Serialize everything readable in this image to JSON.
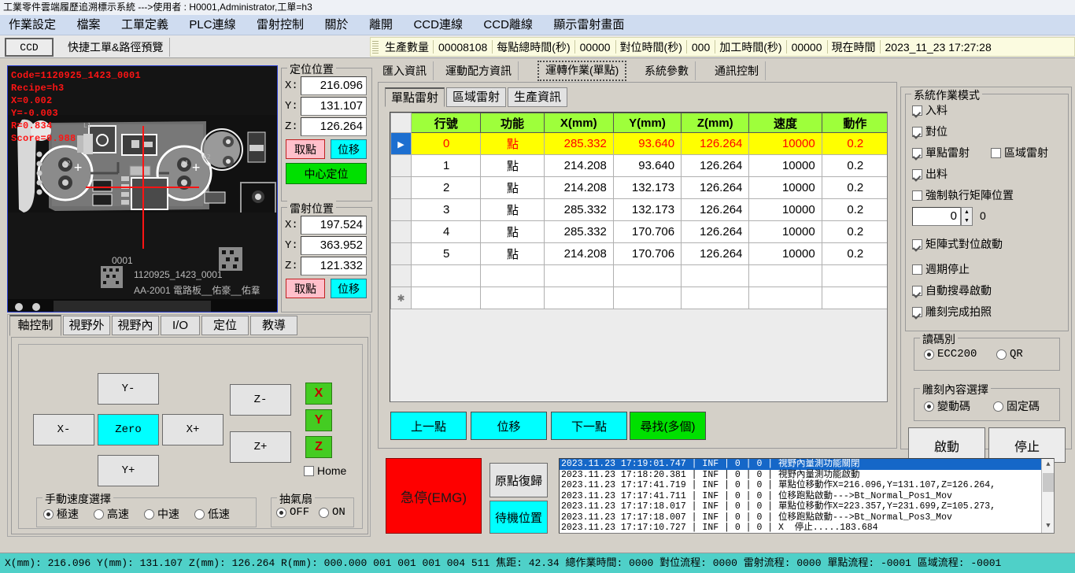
{
  "window": {
    "title": "工業零件雲端履歷追溯標示系統 --->使用者 : H0001,Administrator,工單=h3"
  },
  "menu": {
    "items": [
      "作業設定",
      "檔案",
      "工單定義",
      "PLC連線",
      "雷射控制",
      "關於",
      "離開",
      "CCD連線",
      "CCD離線",
      "顯示雷射畫面"
    ]
  },
  "tabstrip": {
    "ccd_tab": "CCD",
    "shortcut_label": "快捷工單&路徑預覽"
  },
  "statustool": {
    "qty_label": "生產數量",
    "qty_value": "00008108",
    "point_time_label": "每點總時間(秒)",
    "point_time_value": "00000",
    "align_time_label": "對位時間(秒)",
    "align_time_value": "000",
    "process_time_label": "加工時間(秒)",
    "process_time_value": "00000",
    "now_label": "現在時間",
    "now_value": "2023_11_23  17:27:28"
  },
  "camera": {
    "overlay": [
      "Code=1120925_1423_0001",
      "Recipe=h3",
      "X=0.002",
      "Y=-0.003",
      "R=0.834",
      "Score=0.988"
    ],
    "board_labels": [
      "0001",
      "1120925_1423_0001",
      "AA-2001  電路板__佑豪__佑羣"
    ]
  },
  "locate_group": {
    "title": "定位位置",
    "x_label": "X:",
    "x_value": "216.096",
    "y_label": "Y:",
    "y_value": "131.107",
    "z_label": "Z:",
    "z_value": "126.264",
    "pick_button": "取點",
    "move_button": "位移",
    "center_button": "中心定位"
  },
  "laser_group": {
    "title": "雷射位置",
    "x_label": "X:",
    "x_value": "197.524",
    "y_label": "Y:",
    "y_value": "363.952",
    "z_label": "Z:",
    "z_value": "121.332",
    "pick_button": "取點",
    "move_button": "位移"
  },
  "left_tabs": {
    "items": [
      "軸控制",
      "視野外",
      "視野內",
      "I/O",
      "定位",
      "教導"
    ],
    "active": 0
  },
  "jog": {
    "y_minus": "Y-",
    "y_plus": "Y+",
    "x_minus": "X-",
    "x_plus": "X+",
    "zero": "Zero",
    "z_minus": "Z-",
    "z_plus": "Z+",
    "axis_x": "X",
    "axis_y": "Y",
    "axis_z": "Z",
    "home_label": "Home",
    "home_checked": false,
    "speed_group": "手動速度選擇",
    "speed_options": [
      "極速",
      "高速",
      "中速",
      "低速"
    ],
    "speed_selected": 0,
    "fan_group": "抽氣扇",
    "fan_options": [
      "OFF",
      "ON"
    ],
    "fan_selected": 0
  },
  "main_tabs": {
    "items": [
      "匯入資訊",
      "運動配方資訊",
      "運轉作業(單點)",
      "系統參數",
      "通訊控制"
    ],
    "active": 2
  },
  "sub_tabs": {
    "items": [
      "單點雷射",
      "區域雷射",
      "生產資訊"
    ],
    "active": 0
  },
  "grid": {
    "headers": [
      "行號",
      "功能",
      "X(mm)",
      "Y(mm)",
      "Z(mm)",
      "速度",
      "動作"
    ],
    "rows": [
      {
        "no": "0",
        "func": "點",
        "x": "285.332",
        "y": "93.640",
        "z": "126.264",
        "speed": "10000",
        "act": "0.2",
        "selected": true
      },
      {
        "no": "1",
        "func": "點",
        "x": "214.208",
        "y": "93.640",
        "z": "126.264",
        "speed": "10000",
        "act": "0.2",
        "selected": false
      },
      {
        "no": "2",
        "func": "點",
        "x": "214.208",
        "y": "132.173",
        "z": "126.264",
        "speed": "10000",
        "act": "0.2",
        "selected": false
      },
      {
        "no": "3",
        "func": "點",
        "x": "285.332",
        "y": "132.173",
        "z": "126.264",
        "speed": "10000",
        "act": "0.2",
        "selected": false
      },
      {
        "no": "4",
        "func": "點",
        "x": "285.332",
        "y": "170.706",
        "z": "126.264",
        "speed": "10000",
        "act": "0.2",
        "selected": false
      },
      {
        "no": "5",
        "func": "點",
        "x": "214.208",
        "y": "170.706",
        "z": "126.264",
        "speed": "10000",
        "act": "0.2",
        "selected": false
      },
      {
        "no": "",
        "func": "",
        "x": "",
        "y": "",
        "z": "",
        "speed": "",
        "act": "",
        "selected": false
      },
      {
        "no": "",
        "func": "",
        "x": "",
        "y": "",
        "z": "",
        "speed": "",
        "act": "",
        "selected": false,
        "newrow": true
      }
    ]
  },
  "grid_buttons": {
    "prev": "上一點",
    "move": "位移",
    "next": "下一點",
    "find": "尋找(多個)"
  },
  "right_panel": {
    "mode_group": "系統作業模式",
    "checkboxes": [
      {
        "label": "入料",
        "checked": true
      },
      {
        "label": "對位",
        "checked": true
      },
      {
        "label": "單點雷射",
        "checked": true
      },
      {
        "label": "區域雷射",
        "checked": false
      },
      {
        "label": "出料",
        "checked": true
      },
      {
        "label": "強制執行矩陣位置",
        "checked": false
      },
      {
        "label": "矩陣式對位啟動",
        "checked": true
      },
      {
        "label": "週期停止",
        "checked": false
      },
      {
        "label": "自動搜尋啟動",
        "checked": true
      },
      {
        "label": "雕刻完成拍照",
        "checked": true
      }
    ],
    "spinner_value": "0",
    "spinner_side_value": "0",
    "code_group": "讀碼別",
    "code_options": [
      "ECC200",
      "QR"
    ],
    "code_selected": 0,
    "content_group": "雕刻內容選擇",
    "content_options": [
      "變動碼",
      "固定碼"
    ],
    "content_selected": 0,
    "start_button": "啟動",
    "stop_button": "停止"
  },
  "bottom": {
    "emg_button": "急停(EMG)",
    "home_button": "原點復歸",
    "standby_button": "待機位置"
  },
  "log": {
    "lines": [
      {
        "text": "2023.11.23 17:19:01.747 | INF | 0 | 0 | 視野內量測功能關閉",
        "selected": true
      },
      {
        "text": "2023.11.23 17:18:20.381 | INF | 0 | 0 | 視野內量測功能啟動",
        "selected": false
      },
      {
        "text": "2023.11.23 17:17:41.719 | INF | 0 | 0 | 單點位移動作X=216.096,Y=131.107,Z=126.264,",
        "selected": false
      },
      {
        "text": "2023.11.23 17:17:41.711 | INF | 0 | 0 | 位移跑點啟動--->Bt_Normal_Pos1_Mov",
        "selected": false
      },
      {
        "text": "2023.11.23 17:17:18.017 | INF | 0 | 0 | 單點位移動作X=223.357,Y=231.699,Z=105.273,",
        "selected": false
      },
      {
        "text": "2023.11.23 17:17:18.007 | INF | 0 | 0 | 位移跑點啟動--->Bt_Normal_Pos3_Mov",
        "selected": false
      },
      {
        "text": "2023.11.23 17:17:10.727 | INF | 0 | 0 | X  停止.....183.684",
        "selected": false
      }
    ]
  },
  "statusbar": {
    "text": "X(mm): 216.096 Y(mm): 131.107 Z(mm): 126.264 R(mm): 000.000 001 001 001 004 511 焦距: 42.34 總作業時間: 0000 對位流程: 0000  雷射流程: 0000  單點流程: -0001  區域流程: -0001"
  },
  "colors": {
    "accent_cyan": "#00ffff",
    "accent_green": "#00e000",
    "emg_red": "#fe0000",
    "header_green": "#9eff3b",
    "select_yellow": "#ffff00",
    "overlay_red": "#ff1414",
    "statusbar_teal": "#4fd0c8"
  }
}
